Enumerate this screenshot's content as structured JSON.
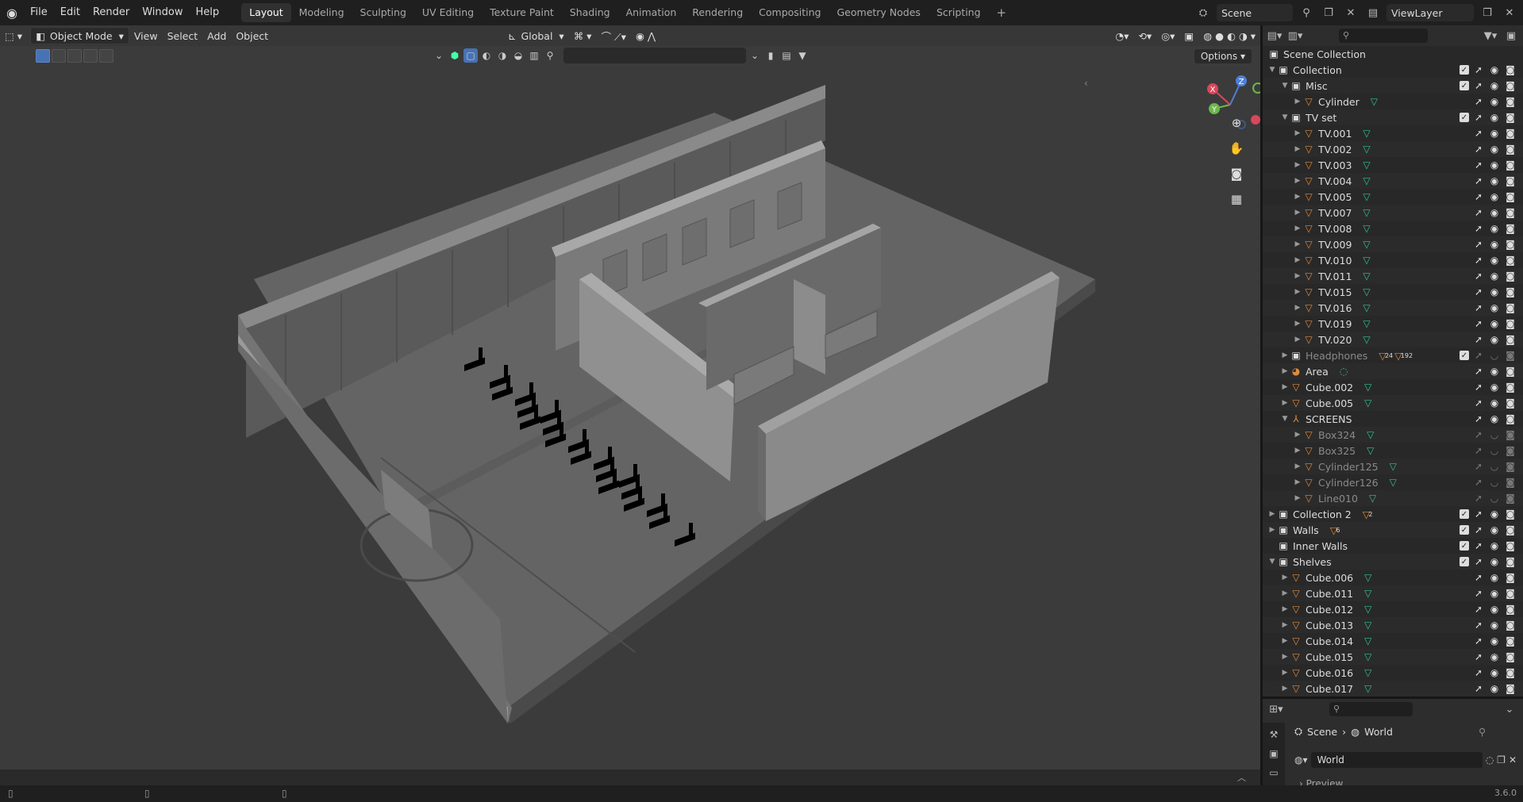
{
  "topbar": {
    "menus": [
      "File",
      "Edit",
      "Render",
      "Window",
      "Help"
    ],
    "workspaces": [
      "Layout",
      "Modeling",
      "Sculpting",
      "UV Editing",
      "Texture Paint",
      "Shading",
      "Animation",
      "Rendering",
      "Compositing",
      "Geometry Nodes",
      "Scripting"
    ],
    "active_workspace": "Layout",
    "add_tab": "+",
    "scene": "Scene",
    "view_layer": "ViewLayer"
  },
  "viewport": {
    "mode": "Object Mode",
    "menus": [
      "View",
      "Select",
      "Add",
      "Object"
    ],
    "orientation": "Global",
    "options_label": "Options",
    "gizmo_axes": [
      "X",
      "Y",
      "Z"
    ]
  },
  "outliner": {
    "root": "Scene Collection",
    "rows": [
      {
        "name": "Collection",
        "type": "collection",
        "open": true,
        "checked": true
      },
      {
        "name": "Misc",
        "type": "collection",
        "open": true,
        "checked": true
      },
      {
        "name": "Cylinder",
        "type": "object",
        "mesh": true
      },
      {
        "name": "TV set",
        "type": "collection",
        "open": true,
        "checked": true
      },
      {
        "name": "TV.001",
        "type": "object",
        "mesh": true
      },
      {
        "name": "TV.002",
        "type": "object",
        "mesh": true
      },
      {
        "name": "TV.003",
        "type": "object",
        "mesh": true
      },
      {
        "name": "TV.004",
        "type": "object",
        "mesh": true
      },
      {
        "name": "TV.005",
        "type": "object",
        "mesh": true
      },
      {
        "name": "TV.007",
        "type": "object",
        "mesh": true
      },
      {
        "name": "TV.008",
        "type": "object",
        "mesh": true
      },
      {
        "name": "TV.009",
        "type": "object",
        "mesh": true
      },
      {
        "name": "TV.010",
        "type": "object",
        "mesh": true
      },
      {
        "name": "TV.011",
        "type": "object",
        "mesh": true
      },
      {
        "name": "TV.015",
        "type": "object",
        "mesh": true
      },
      {
        "name": "TV.016",
        "type": "object",
        "mesh": true
      },
      {
        "name": "TV.019",
        "type": "object",
        "mesh": true
      },
      {
        "name": "TV.020",
        "type": "object",
        "mesh": true
      },
      {
        "name": "Headphones",
        "type": "collection",
        "checked": true,
        "dim": true,
        "counts": [
          "24",
          "192"
        ]
      },
      {
        "name": "Area",
        "type": "light"
      },
      {
        "name": "Cube.002",
        "type": "object",
        "mesh": true
      },
      {
        "name": "Cube.005",
        "type": "object",
        "mesh": true
      },
      {
        "name": "SCREENS",
        "type": "empty",
        "open": true
      },
      {
        "name": "Box324",
        "type": "object",
        "mesh": true,
        "dim": true
      },
      {
        "name": "Box325",
        "type": "object",
        "mesh": true,
        "dim": true
      },
      {
        "name": "Cylinder125",
        "type": "object",
        "mesh": true,
        "dim": true
      },
      {
        "name": "Cylinder126",
        "type": "object",
        "mesh": true,
        "dim": true
      },
      {
        "name": "Line010",
        "type": "object",
        "mesh": true,
        "dim": true
      },
      {
        "name": "Collection 2",
        "type": "collection",
        "checked": true,
        "counts": [
          "2"
        ]
      },
      {
        "name": "Walls",
        "type": "collection",
        "checked": true,
        "counts": [
          "6"
        ]
      },
      {
        "name": "Inner Walls",
        "type": "collection",
        "checked": true
      },
      {
        "name": "Shelves",
        "type": "collection",
        "open": true,
        "checked": true
      },
      {
        "name": "Cube.006",
        "type": "object",
        "mesh": true
      },
      {
        "name": "Cube.011",
        "type": "object",
        "mesh": true
      },
      {
        "name": "Cube.012",
        "type": "object",
        "mesh": true
      },
      {
        "name": "Cube.013",
        "type": "object",
        "mesh": true
      },
      {
        "name": "Cube.014",
        "type": "object",
        "mesh": true
      },
      {
        "name": "Cube.015",
        "type": "object",
        "mesh": true
      },
      {
        "name": "Cube.016",
        "type": "object",
        "mesh": true
      },
      {
        "name": "Cube.017",
        "type": "object",
        "mesh": true
      }
    ]
  },
  "properties": {
    "breadcrumb": [
      "Scene",
      "World"
    ],
    "world_name": "World",
    "panel": "Preview"
  },
  "status": {
    "version": "3.6.0"
  },
  "colors": {
    "accent": "#4772b3",
    "object": "#e08a3c",
    "mesh": "#2fc19a",
    "viewport_bg": "#3b3b3b"
  }
}
